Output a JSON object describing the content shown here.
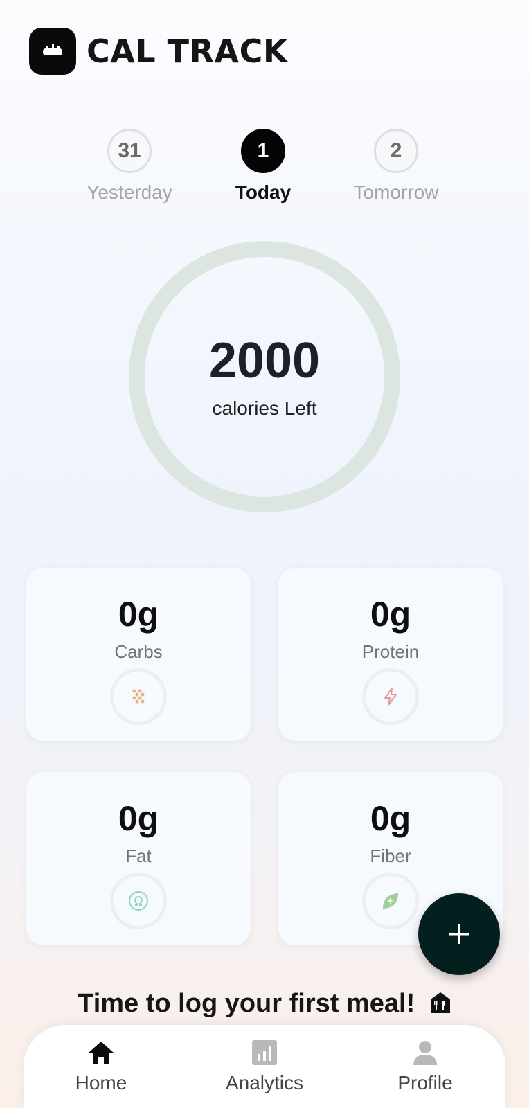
{
  "app": {
    "title": "CAL TRACK",
    "logo_icon": "scale-icon"
  },
  "days": [
    {
      "number": "31",
      "label": "Yesterday",
      "active": false
    },
    {
      "number": "1",
      "label": "Today",
      "active": true
    },
    {
      "number": "2",
      "label": "Tomorrow",
      "active": false
    }
  ],
  "calories": {
    "value": "2000",
    "caption": "calories Left",
    "progress": 0
  },
  "macros": [
    {
      "value": "0g",
      "label": "Carbs",
      "icon": "grain-icon",
      "color": "#e2b57a"
    },
    {
      "value": "0g",
      "label": "Protein",
      "icon": "lightning-icon",
      "color": "#e09a9a"
    },
    {
      "value": "0g",
      "label": "Fat",
      "icon": "omega-icon",
      "color": "#8fd3c6"
    },
    {
      "value": "0g",
      "label": "Fiber",
      "icon": "leaf-icon",
      "color": "#9fcf9a"
    }
  ],
  "fab": {
    "icon": "plus-icon"
  },
  "prompt": {
    "text": "Time to log your first meal!",
    "icon": "meal-icon"
  },
  "nav": [
    {
      "label": "Home",
      "icon": "home-icon",
      "active": true
    },
    {
      "label": "Analytics",
      "icon": "analytics-icon",
      "active": false
    },
    {
      "label": "Profile",
      "icon": "profile-icon",
      "active": false
    }
  ],
  "colors": {
    "accent": "#04201e",
    "ring": "#dce5e0",
    "active_day": "#050505"
  }
}
